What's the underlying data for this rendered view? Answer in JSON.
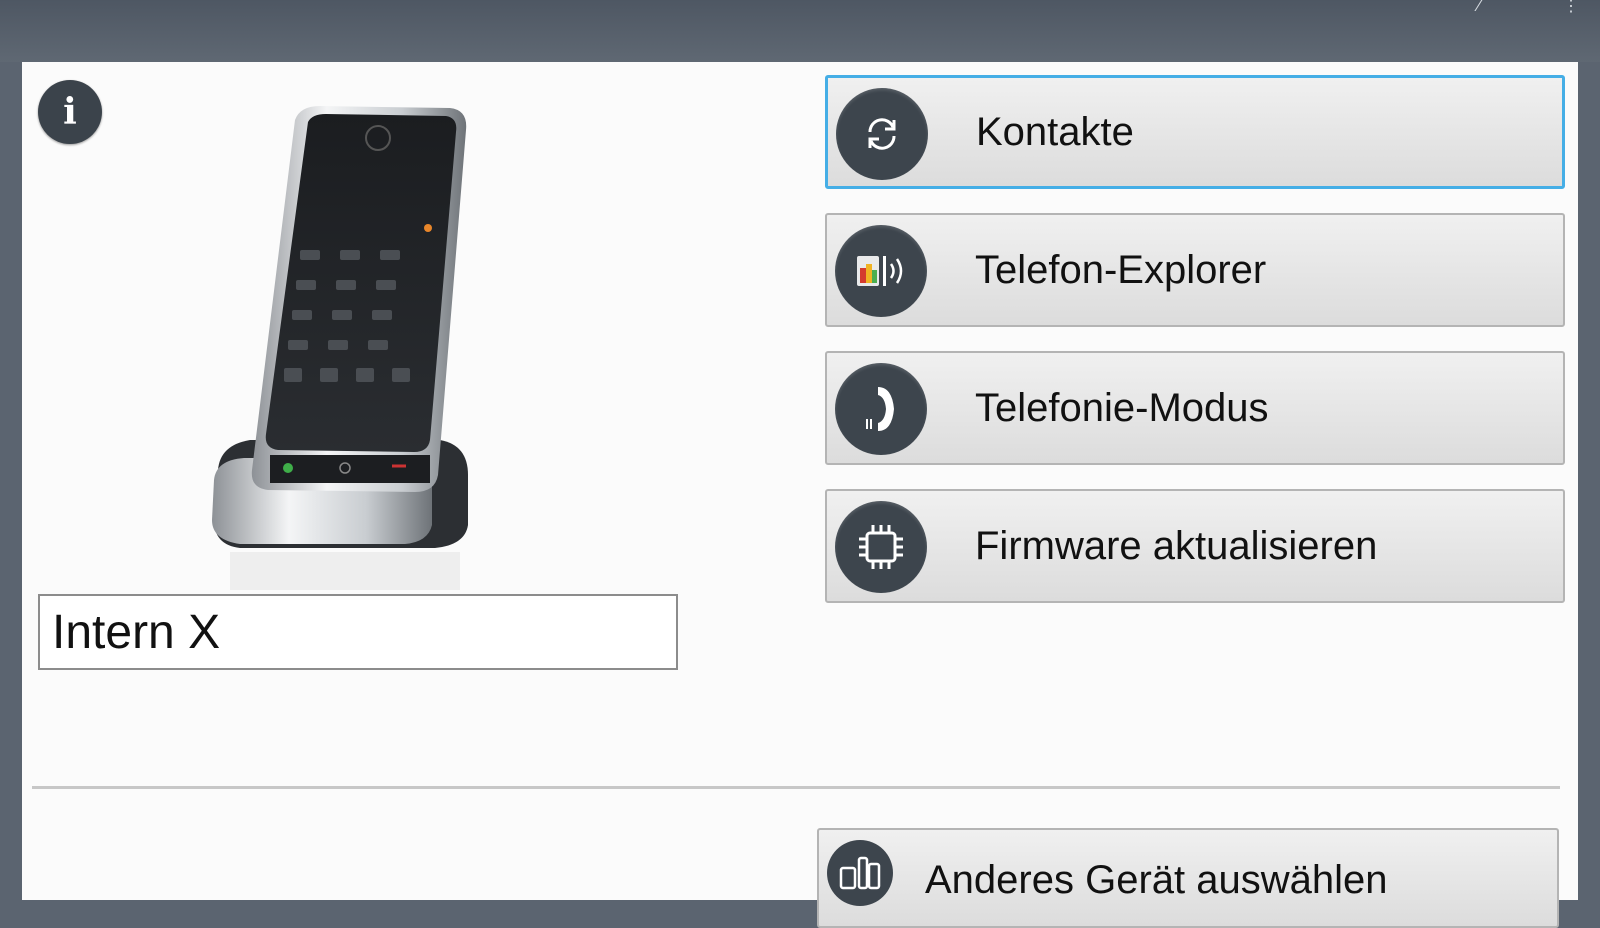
{
  "window": {
    "titlebar_icons": [
      "edit-icon",
      "more-icon"
    ]
  },
  "device": {
    "name_value": "Intern X",
    "image": "gigaset-handset-image"
  },
  "info_button": {
    "glyph": "i"
  },
  "menu": {
    "items": [
      {
        "label": "Kontakte",
        "icon": "sync-icon",
        "focused": true
      },
      {
        "label": "Telefon-Explorer",
        "icon": "phone-explorer-icon",
        "focused": false
      },
      {
        "label": "Telefonie-Modus",
        "icon": "handset-mode-icon",
        "focused": false
      },
      {
        "label": "Firmware aktualisieren",
        "icon": "chip-icon",
        "focused": false
      }
    ]
  },
  "bottom": {
    "select_device_label": "Anderes Gerät auswählen",
    "icon": "devices-icon"
  },
  "colors": {
    "focus_border": "#45aee6",
    "icon_bg": "#3d454d",
    "frame": "#5b6470"
  }
}
